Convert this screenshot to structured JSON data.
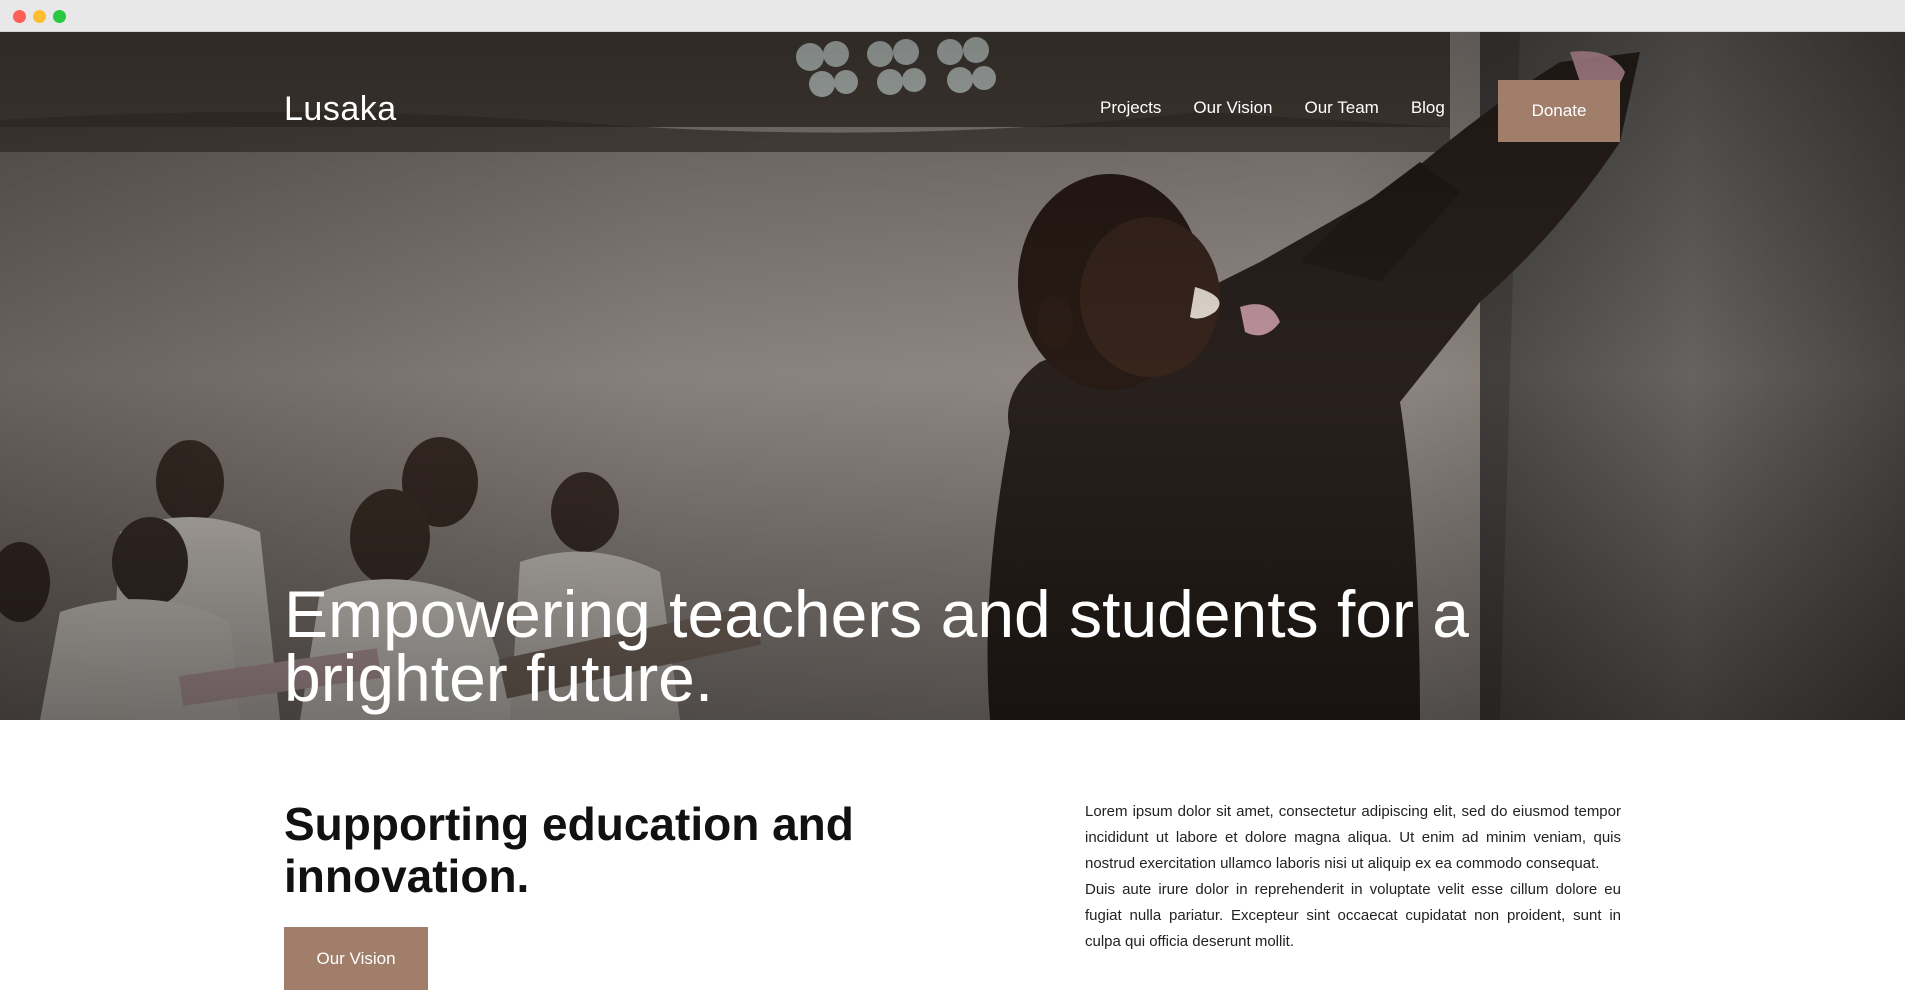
{
  "browser": {
    "controls": [
      "close",
      "minimize",
      "maximize"
    ]
  },
  "header": {
    "logo": "Lusaka",
    "nav": [
      {
        "label": "Projects"
      },
      {
        "label": "Our Vision"
      },
      {
        "label": "Our Team"
      },
      {
        "label": "Blog"
      }
    ],
    "donate_label": "Donate"
  },
  "hero": {
    "title": "Empowering teachers and students for a brighter future.",
    "image_alt": "Teacher writing on a chalkboard in front of a classroom of students"
  },
  "intro": {
    "title": "Supporting education and innovation.",
    "button_label": "Our Vision",
    "paragraphs": [
      "Lorem ipsum dolor sit amet, consectetur adipiscing elit, sed do eiusmod tempor incididunt ut labore et dolore magna aliqua. Ut enim ad minim veniam, quis nostrud exercitation ullamco laboris nisi ut aliquip ex ea commodo consequat.",
      "Duis aute irure dolor in reprehenderit in voluptate velit esse cillum dolore eu fugiat nulla pariatur. Excepteur sint occaecat cupidatat non proident, sunt in culpa qui officia deserunt mollit."
    ]
  },
  "colors": {
    "accent": "#a07e6a",
    "chrome": "#e8e8e8",
    "text_dark": "#111111"
  }
}
